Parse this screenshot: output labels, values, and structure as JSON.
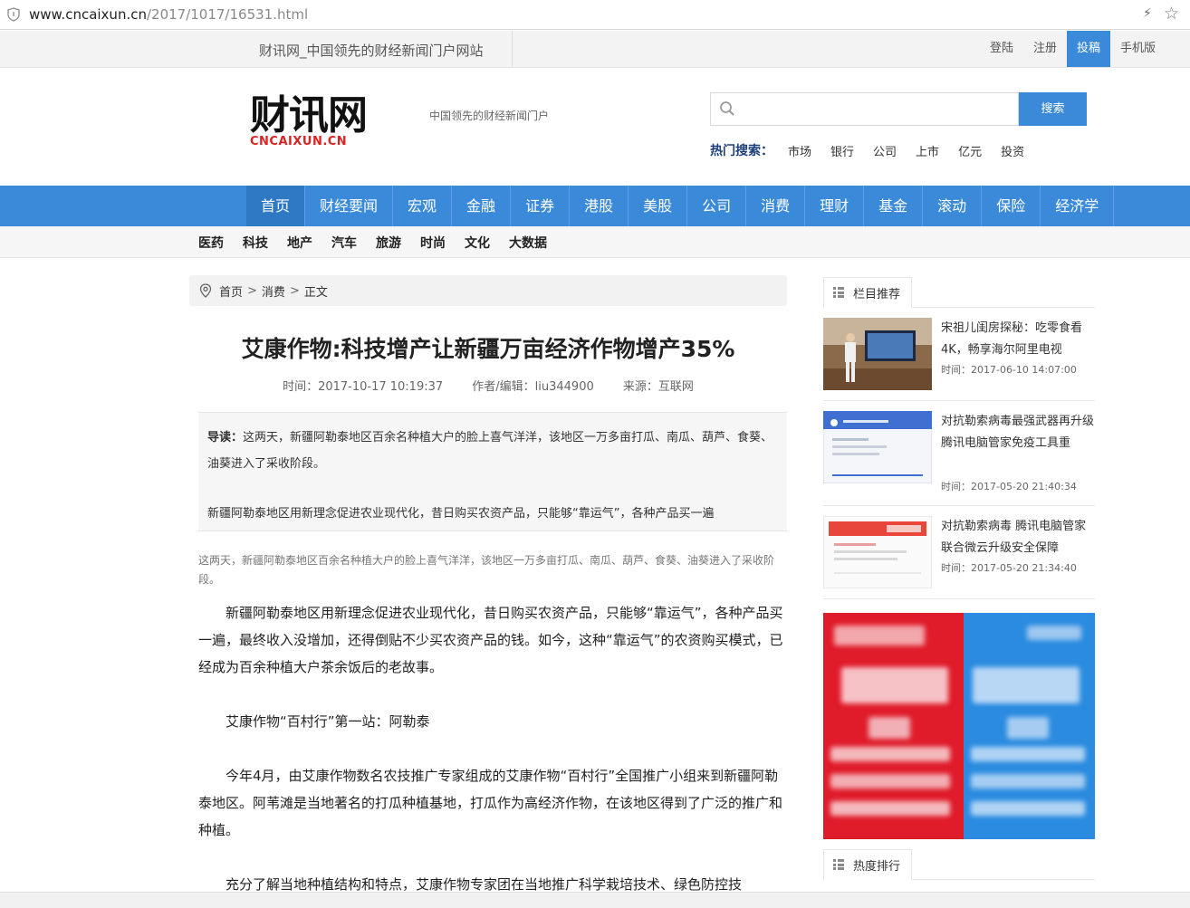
{
  "browser": {
    "url_host": "www.cncaixun.cn",
    "url_path": "/2017/1017/16531.html"
  },
  "topbar": {
    "slogan": "财讯网_中国领先的财经新闻门户网站",
    "links": [
      {
        "label": "登陆",
        "active": false
      },
      {
        "label": "注册",
        "active": false
      },
      {
        "label": "投稿",
        "active": true
      },
      {
        "label": "手机版",
        "active": false
      }
    ]
  },
  "header": {
    "logo_cn": "财讯网",
    "logo_en": "CNCAIXUN.CN",
    "tagline": "中国领先的财经新闻门户",
    "search_placeholder": "",
    "search_button": "搜索",
    "hot_label": "热门搜索：",
    "hot_keywords": [
      "市场",
      "银行",
      "公司",
      "上市",
      "亿元",
      "投资"
    ]
  },
  "nav": {
    "main": [
      "首页",
      "财经要闻",
      "宏观",
      "金融",
      "证券",
      "港股",
      "美股",
      "公司",
      "消费",
      "理财",
      "基金",
      "滚动",
      "保险",
      "经济学"
    ],
    "main_active": "首页",
    "sub": [
      "医药",
      "科技",
      "地产",
      "汽车",
      "旅游",
      "时尚",
      "文化",
      "大数据"
    ]
  },
  "breadcrumb": {
    "items": [
      "首页",
      "消费",
      "正文"
    ],
    "separator": ">"
  },
  "article": {
    "title": "艾康作物:科技增产让新疆万亩经济作物增产35%",
    "time": "时间：2017-10-17 10:19:37",
    "author": "作者/编辑：liu344900",
    "source": "来源：互联网",
    "lead_label": "导读：",
    "lead_text": "这两天，新疆阿勒泰地区百余名种植大户的脸上喜气洋洋，该地区一万多亩打瓜、南瓜、葫芦、食葵、油葵进入了采收阶段。",
    "lead_para2": "新疆阿勒泰地区用新理念促进农业现代化，昔日购买农资产品，只能够“靠运气”，各种产品买一遍",
    "summary": "这两天，新疆阿勒泰地区百余名种植大户的脸上喜气洋洋，该地区一万多亩打瓜、南瓜、葫芦、食葵、油葵进入了采收阶段。",
    "paragraphs": [
      "新疆阿勒泰地区用新理念促进农业现代化，昔日购买农资产品，只能够“靠运气”，各种产品买一遍，最终收入没增加，还得倒贴不少买农资产品的钱。如今，这种“靠运气”的农资购买模式，已经成为百余种植大户茶余饭后的老故事。",
      "艾康作物“百村行”第一站：阿勒泰",
      "今年4月，由艾康作物数名农技推广专家组成的艾康作物“百村行”全国推广小组来到新疆阿勒泰地区。阿苇滩是当地著名的打瓜种植基地，打瓜作为高经济作物，在该地区得到了广泛的推广和种植。",
      "充分了解当地种植结构和特点，艾康作物专家团在当地推广科学栽培技术、绿色防控技"
    ]
  },
  "sidebar": {
    "recommend_title": "栏目推荐",
    "news": [
      {
        "title": "宋祖儿闺房探秘：吃零食看4K，畅享海尔阿里电视",
        "time": "时间：2017-06-10 14:07:00"
      },
      {
        "title": "对抗勒索病毒最强武器再升级 腾讯电脑管家免疫工具重",
        "time": "时间：2017-05-20 21:40:34"
      },
      {
        "title": "对抗勒索病毒 腾讯电脑管家联合微云升级安全保障",
        "time": "时间：2017-05-20 21:34:40"
      }
    ],
    "ranking_title": "热度排行"
  },
  "colors": {
    "accent": "#3a8ad9",
    "logo_red": "#dd2222",
    "ad_red": "#e01b2a",
    "ad_blue": "#2a8be0"
  }
}
